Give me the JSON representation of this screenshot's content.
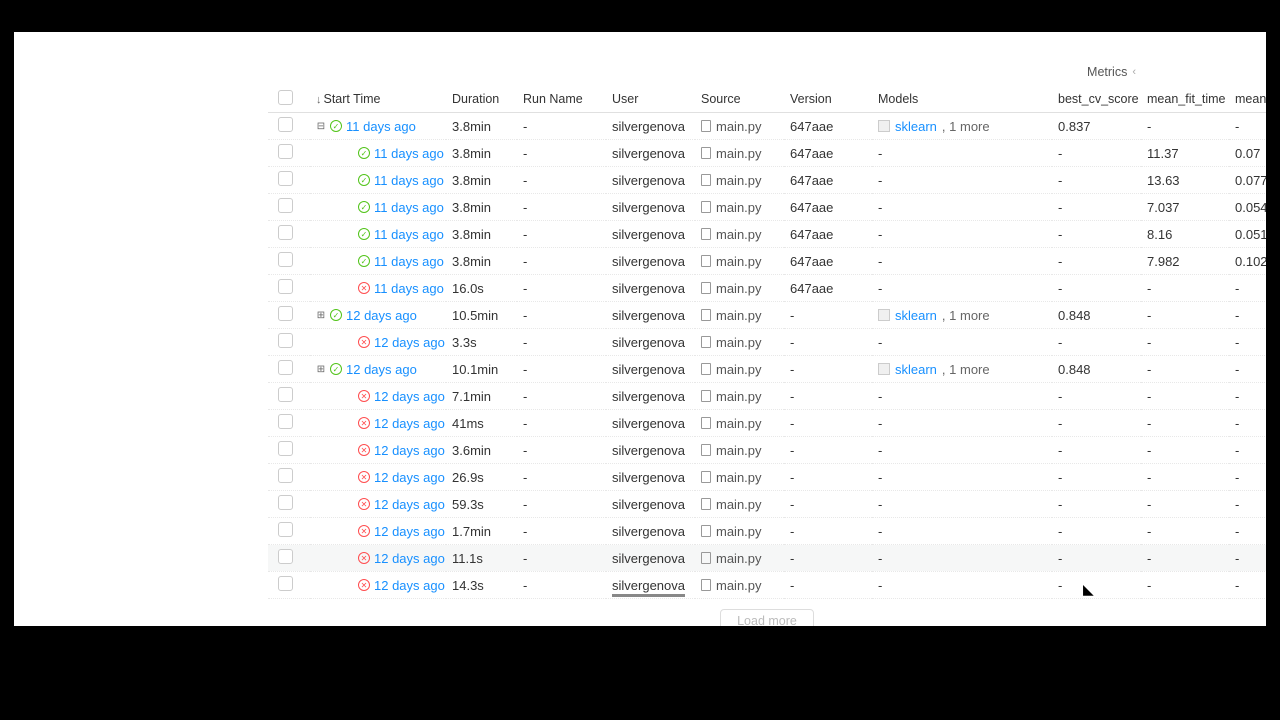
{
  "header": {
    "metrics_label": "Metrics"
  },
  "columns": {
    "start_time": "Start Time",
    "duration": "Duration",
    "run_name": "Run Name",
    "user": "User",
    "source": "Source",
    "version": "Version",
    "models": "Models",
    "best_cv_score": "best_cv_score",
    "mean_fit_time": "mean_fit_time",
    "mean": "mean"
  },
  "rows": [
    {
      "indent": 0,
      "expander": "minus",
      "status": "success",
      "time": "11 days ago",
      "duration": "3.8min",
      "run_name": "-",
      "user": "silvergenova",
      "source": "main.py",
      "version": "647aae",
      "models": "sklearn",
      "models_more": ", 1 more",
      "best_cv_score": "0.837",
      "mean_fit_time": "-",
      "mean": "-"
    },
    {
      "indent": 1,
      "expander": "",
      "status": "success",
      "time": "11 days ago",
      "duration": "3.8min",
      "run_name": "-",
      "user": "silvergenova",
      "source": "main.py",
      "version": "647aae",
      "models": "-",
      "best_cv_score": "-",
      "mean_fit_time": "11.37",
      "mean": "0.07"
    },
    {
      "indent": 1,
      "expander": "",
      "status": "success",
      "time": "11 days ago",
      "duration": "3.8min",
      "run_name": "-",
      "user": "silvergenova",
      "source": "main.py",
      "version": "647aae",
      "models": "-",
      "best_cv_score": "-",
      "mean_fit_time": "13.63",
      "mean": "0.077"
    },
    {
      "indent": 1,
      "expander": "",
      "status": "success",
      "time": "11 days ago",
      "duration": "3.8min",
      "run_name": "-",
      "user": "silvergenova",
      "source": "main.py",
      "version": "647aae",
      "models": "-",
      "best_cv_score": "-",
      "mean_fit_time": "7.037",
      "mean": "0.054"
    },
    {
      "indent": 1,
      "expander": "",
      "status": "success",
      "time": "11 days ago",
      "duration": "3.8min",
      "run_name": "-",
      "user": "silvergenova",
      "source": "main.py",
      "version": "647aae",
      "models": "-",
      "best_cv_score": "-",
      "mean_fit_time": "8.16",
      "mean": "0.051"
    },
    {
      "indent": 1,
      "expander": "",
      "status": "success",
      "time": "11 days ago",
      "duration": "3.8min",
      "run_name": "-",
      "user": "silvergenova",
      "source": "main.py",
      "version": "647aae",
      "models": "-",
      "best_cv_score": "-",
      "mean_fit_time": "7.982",
      "mean": "0.102"
    },
    {
      "indent": 1,
      "expander": "",
      "status": "fail",
      "time": "11 days ago",
      "duration": "16.0s",
      "run_name": "-",
      "user": "silvergenova",
      "source": "main.py",
      "version": "647aae",
      "models": "-",
      "best_cv_score": "-",
      "mean_fit_time": "-",
      "mean": "-"
    },
    {
      "indent": 0,
      "expander": "plus",
      "status": "success",
      "time": "12 days ago",
      "duration": "10.5min",
      "run_name": "-",
      "user": "silvergenova",
      "source": "main.py",
      "version": "-",
      "models": "sklearn",
      "models_more": ", 1 more",
      "best_cv_score": "0.848",
      "mean_fit_time": "-",
      "mean": "-"
    },
    {
      "indent": 1,
      "expander": "",
      "status": "fail",
      "time": "12 days ago",
      "duration": "3.3s",
      "run_name": "-",
      "user": "silvergenova",
      "source": "main.py",
      "version": "-",
      "models": "-",
      "best_cv_score": "-",
      "mean_fit_time": "-",
      "mean": "-"
    },
    {
      "indent": 0,
      "expander": "plus",
      "status": "success",
      "time": "12 days ago",
      "duration": "10.1min",
      "run_name": "-",
      "user": "silvergenova",
      "source": "main.py",
      "version": "-",
      "models": "sklearn",
      "models_more": ", 1 more",
      "best_cv_score": "0.848",
      "mean_fit_time": "-",
      "mean": "-"
    },
    {
      "indent": 1,
      "expander": "",
      "status": "fail",
      "time": "12 days ago",
      "duration": "7.1min",
      "run_name": "-",
      "user": "silvergenova",
      "source": "main.py",
      "version": "-",
      "models": "-",
      "best_cv_score": "-",
      "mean_fit_time": "-",
      "mean": "-"
    },
    {
      "indent": 1,
      "expander": "",
      "status": "fail",
      "time": "12 days ago",
      "duration": "41ms",
      "run_name": "-",
      "user": "silvergenova",
      "source": "main.py",
      "version": "-",
      "models": "-",
      "best_cv_score": "-",
      "mean_fit_time": "-",
      "mean": "-"
    },
    {
      "indent": 1,
      "expander": "",
      "status": "fail",
      "time": "12 days ago",
      "duration": "3.6min",
      "run_name": "-",
      "user": "silvergenova",
      "source": "main.py",
      "version": "-",
      "models": "-",
      "best_cv_score": "-",
      "mean_fit_time": "-",
      "mean": "-"
    },
    {
      "indent": 1,
      "expander": "",
      "status": "fail",
      "time": "12 days ago",
      "duration": "26.9s",
      "run_name": "-",
      "user": "silvergenova",
      "source": "main.py",
      "version": "-",
      "models": "-",
      "best_cv_score": "-",
      "mean_fit_time": "-",
      "mean": "-"
    },
    {
      "indent": 1,
      "expander": "",
      "status": "fail",
      "time": "12 days ago",
      "duration": "59.3s",
      "run_name": "-",
      "user": "silvergenova",
      "source": "main.py",
      "version": "-",
      "models": "-",
      "best_cv_score": "-",
      "mean_fit_time": "-",
      "mean": "-"
    },
    {
      "indent": 1,
      "expander": "",
      "status": "fail",
      "time": "12 days ago",
      "duration": "1.7min",
      "run_name": "-",
      "user": "silvergenova",
      "source": "main.py",
      "version": "-",
      "models": "-",
      "best_cv_score": "-",
      "mean_fit_time": "-",
      "mean": "-"
    },
    {
      "indent": 1,
      "expander": "",
      "status": "fail",
      "time": "12 days ago",
      "duration": "11.1s",
      "run_name": "-",
      "user": "silvergenova",
      "source": "main.py",
      "version": "-",
      "models": "-",
      "best_cv_score": "-",
      "mean_fit_time": "-",
      "mean": "-",
      "highlight": true
    },
    {
      "indent": 1,
      "expander": "",
      "status": "fail",
      "time": "12 days ago",
      "duration": "14.3s",
      "run_name": "-",
      "user": "silvergenova",
      "source": "main.py",
      "version": "-",
      "models": "-",
      "best_cv_score": "-",
      "mean_fit_time": "-",
      "mean": "-",
      "underline_user": true
    }
  ],
  "footer": {
    "load_more": "Load more"
  }
}
